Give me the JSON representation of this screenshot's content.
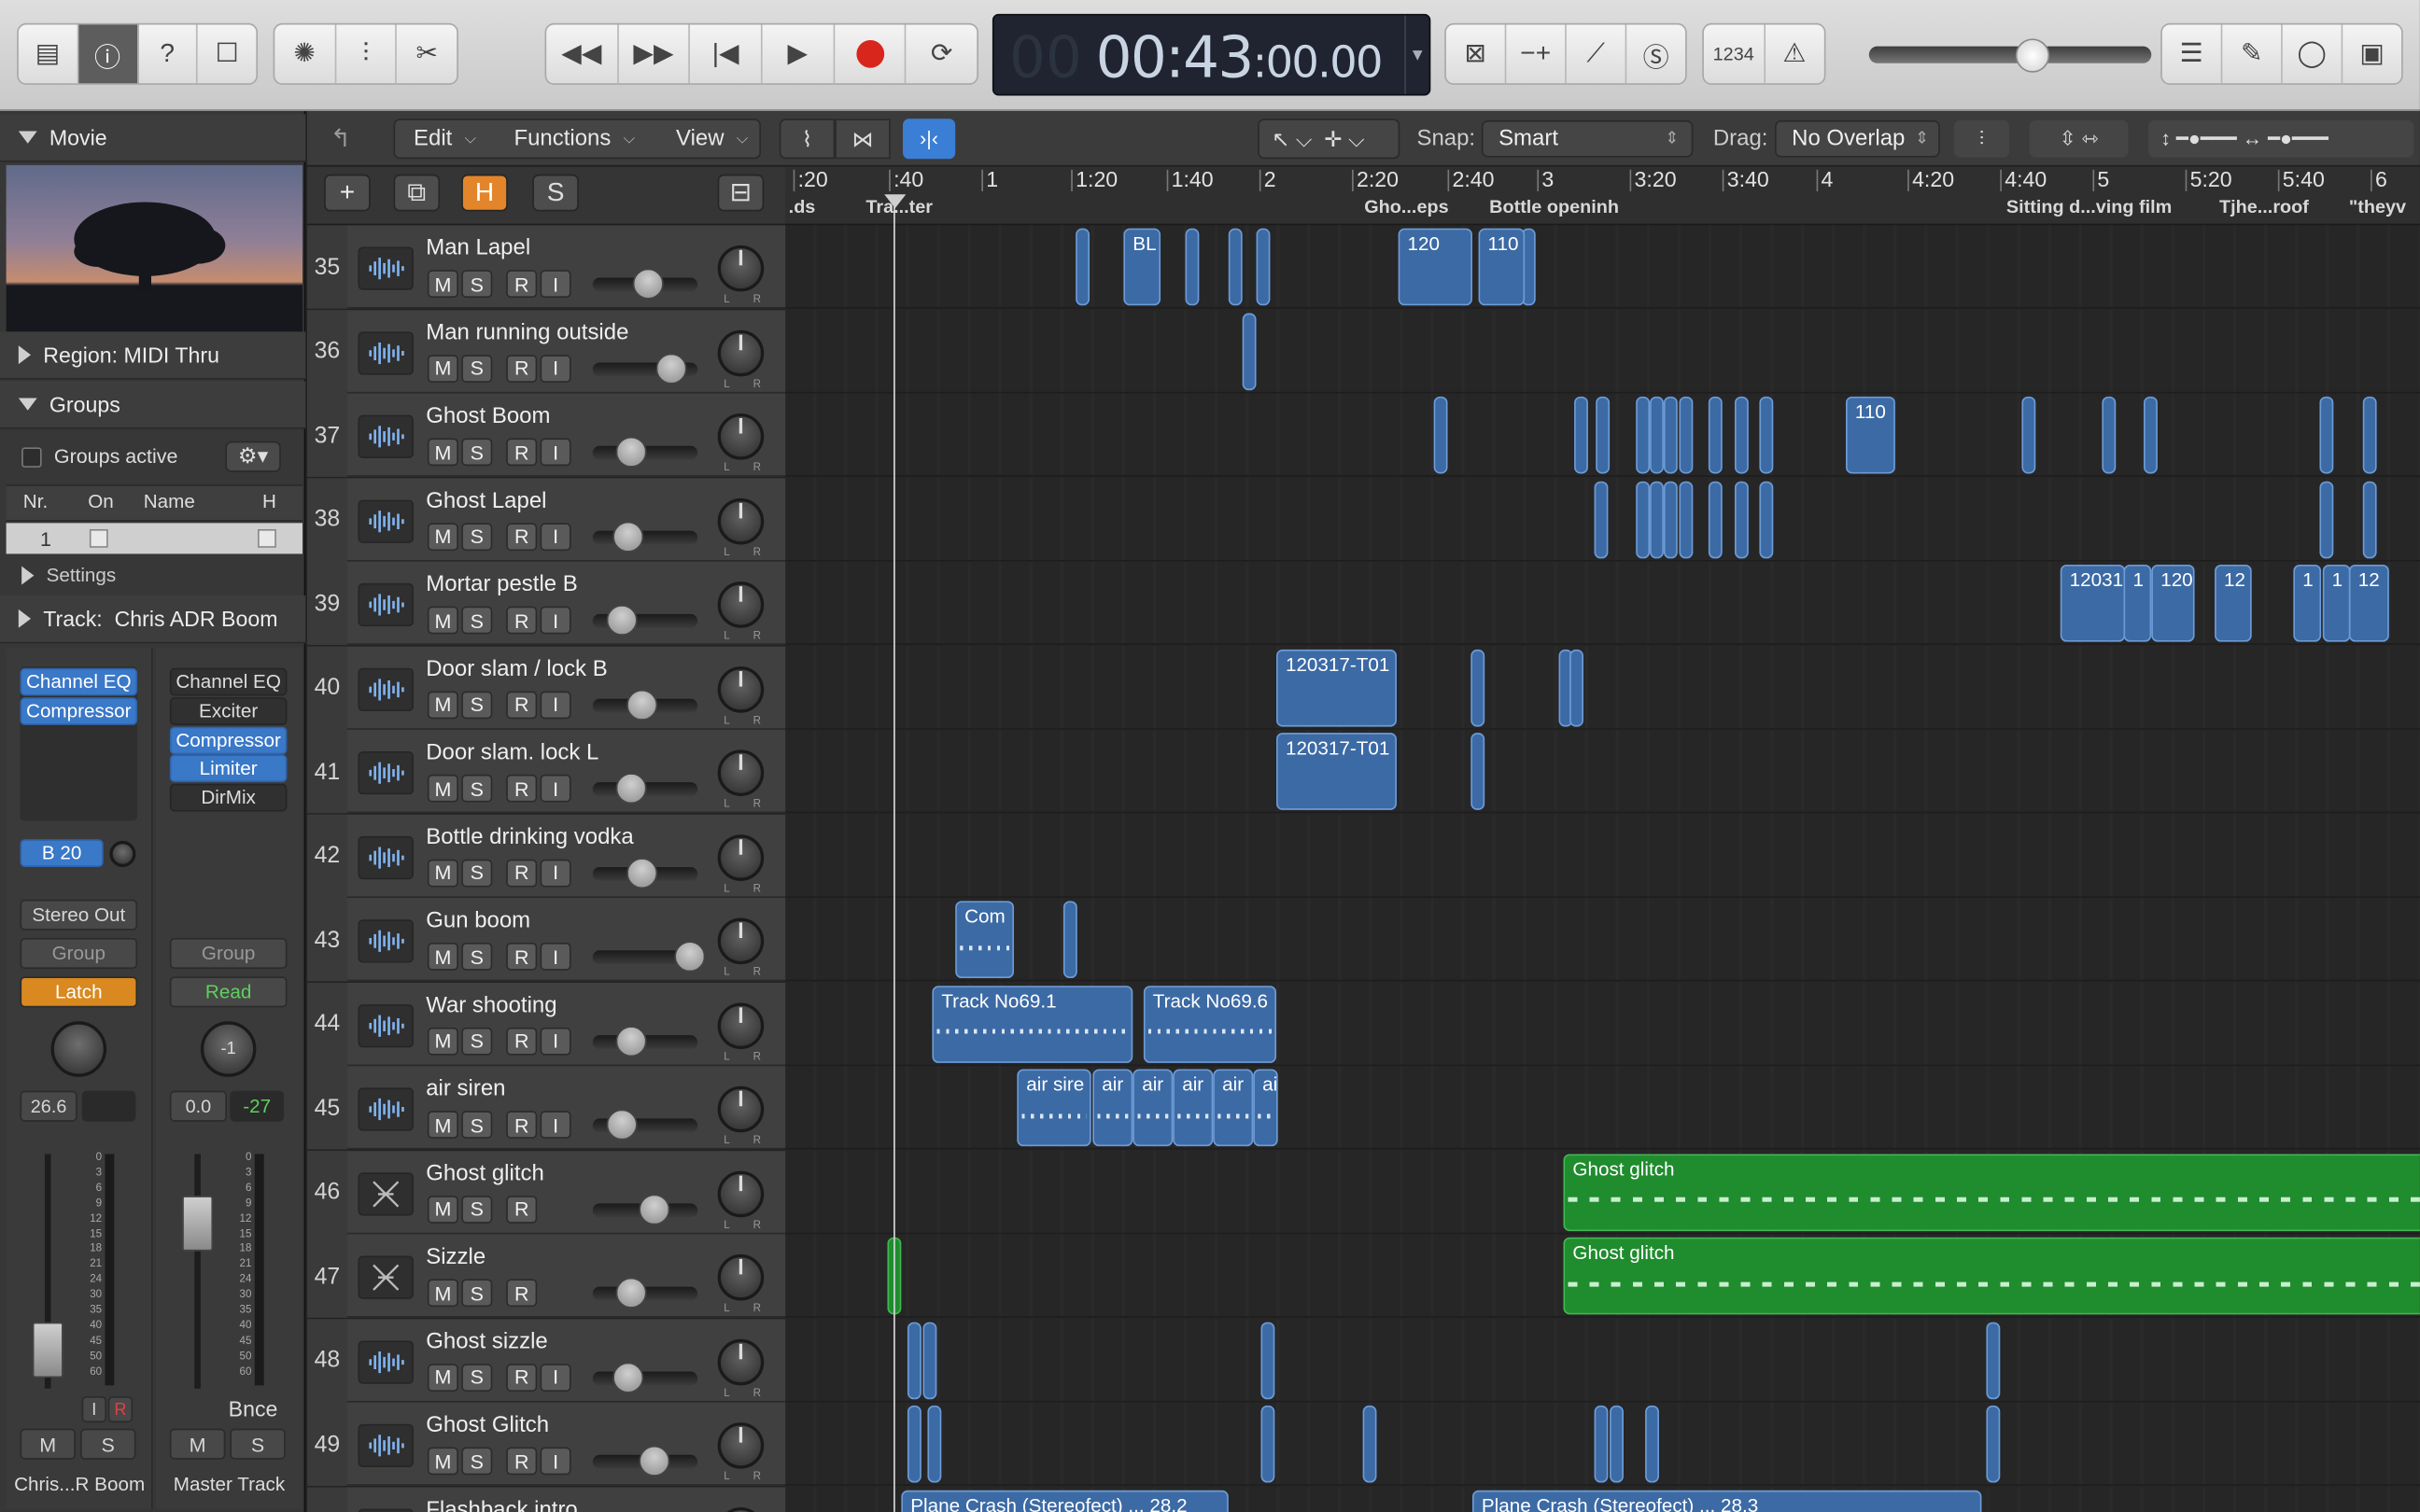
{
  "control_bar": {
    "timecode_ghost": "00",
    "timecode_main": "00:43",
    "timecode_frames": ":00.00",
    "count_in_label": "1234",
    "left_buttons": [
      "library-icon",
      "info-icon",
      "help-icon",
      "toolbar-icon"
    ],
    "mid_buttons": [
      "smart-controls-icon",
      "mixer-icon",
      "scissors-icon"
    ],
    "transport": [
      "rewind-icon",
      "forward-icon",
      "go-to-start-icon",
      "play-icon",
      "record-icon",
      "cycle-icon"
    ],
    "right_buttons": [
      "replace-icon",
      "punch-icon",
      "tuner-icon",
      "solo-icon"
    ],
    "far_right": [
      "list-editors-icon",
      "note-pad-icon",
      "loop-browser-icon",
      "browsers-icon"
    ]
  },
  "arrange_menu": {
    "edit": "Edit",
    "functions": "Functions",
    "view": "View",
    "snap_label": "Snap:",
    "snap_value": "Smart",
    "drag_label": "Drag:",
    "drag_value": "No Overlap"
  },
  "track_header_buttons": {
    "add": "+",
    "h": "H",
    "s": "S"
  },
  "inspector": {
    "movie_label": "Movie",
    "region_label": "Region:",
    "region_value": "MIDI Thru",
    "groups_label": "Groups",
    "groups_active": "Groups active",
    "group_cols": [
      "Nr.",
      "On",
      "Name",
      "H"
    ],
    "group_row_nr": "1",
    "settings_label": "Settings",
    "track_label": "Track:",
    "track_value": "Chris ADR Boom",
    "left_strip": {
      "plugins": [
        "Channel EQ",
        "Compressor"
      ],
      "send": "B 20",
      "output": "Stereo Out",
      "group": "Group",
      "automation": "Latch",
      "volume": "26.6",
      "input_btn": "I",
      "rec_btn": "R",
      "mute": "M",
      "solo": "S",
      "name": "Chris...R Boom"
    },
    "right_strip": {
      "plugins": [
        "Channel EQ",
        "Exciter",
        "Compressor",
        "Limiter",
        "DirMix"
      ],
      "group": "Group",
      "automation": "Read",
      "pan_value": "-1",
      "volume": "0.0",
      "peak": "-27",
      "bounce": "Bnce",
      "mute": "M",
      "solo": "S",
      "name": "Master Track"
    },
    "meter_scale": [
      "0",
      "3",
      "6",
      "9",
      "12",
      "15",
      "18",
      "21",
      "24",
      "30",
      "35",
      "40",
      "45",
      "50",
      "60"
    ]
  },
  "ruler": {
    "ticks": [
      ":20",
      ":40",
      "1",
      "1:20",
      "1:40",
      "2",
      "2:20",
      "2:40",
      "3",
      "3:20",
      "3:40",
      "4",
      "4:20",
      "4:40",
      "5",
      "5:20",
      "5:40",
      "6"
    ],
    "markers": [
      ".ds",
      "Tra...ter",
      "Gho...eps",
      "Bottle openinh",
      "Sitting d...ving film",
      "Tjhe...roof",
      "\"theyv"
    ]
  },
  "tracks": [
    {
      "num": "35",
      "name": "Man Lapel",
      "type": "audio",
      "fader": 0.45,
      "rec": true
    },
    {
      "num": "36",
      "name": "Man running outside",
      "type": "audio",
      "fader": 0.7,
      "rec": true
    },
    {
      "num": "37",
      "name": "Ghost Boom",
      "type": "audio",
      "fader": 0.25,
      "rec": true
    },
    {
      "num": "38",
      "name": "Ghost Lapel",
      "type": "audio",
      "fader": 0.22,
      "rec": true
    },
    {
      "num": "39",
      "name": "Mortar pestle B",
      "type": "audio",
      "fader": 0.15,
      "rec": true
    },
    {
      "num": "40",
      "name": "Door slam / lock B",
      "type": "audio",
      "fader": 0.38,
      "rec": true
    },
    {
      "num": "41",
      "name": "Door slam. lock L",
      "type": "audio",
      "fader": 0.25,
      "rec": true
    },
    {
      "num": "42",
      "name": "Bottle drinking vodka",
      "type": "audio",
      "fader": 0.38,
      "rec": true
    },
    {
      "num": "43",
      "name": "Gun boom",
      "type": "audio",
      "fader": 0.92,
      "rec": true
    },
    {
      "num": "44",
      "name": "War shooting",
      "type": "audio",
      "fader": 0.25,
      "rec": true
    },
    {
      "num": "45",
      "name": "air siren",
      "type": "audio",
      "fader": 0.15,
      "rec": true
    },
    {
      "num": "46",
      "name": "Ghost glitch",
      "type": "instrument",
      "fader": 0.52,
      "rec": false
    },
    {
      "num": "47",
      "name": "Sizzle",
      "type": "instrument",
      "fader": 0.25,
      "rec": false
    },
    {
      "num": "48",
      "name": "Ghost sizzle",
      "type": "audio",
      "fader": 0.22,
      "rec": true
    },
    {
      "num": "49",
      "name": "Ghost Glitch",
      "type": "audio",
      "fader": 0.52,
      "rec": true
    },
    {
      "num": "",
      "name": "Flashback intro",
      "type": "audio",
      "fader": 0.5,
      "rec": true
    }
  ],
  "track_buttons": {
    "m": "M",
    "s": "S",
    "r": "R",
    "i": "I"
  },
  "regions": [
    {
      "row": 0,
      "label": "BL"
    },
    {
      "row": 0,
      "label": "120"
    },
    {
      "row": 0,
      "label": "110"
    },
    {
      "row": 2,
      "label": "110"
    },
    {
      "row": 4,
      "label": "12031"
    },
    {
      "row": 4,
      "label": "1"
    },
    {
      "row": 4,
      "label": "120"
    },
    {
      "row": 4,
      "label": "12"
    },
    {
      "row": 4,
      "label": "1"
    },
    {
      "row": 4,
      "label": "1"
    },
    {
      "row": 4,
      "label": "12"
    },
    {
      "row": 5,
      "label": "120317-T01"
    },
    {
      "row": 6,
      "label": "120317-T01"
    },
    {
      "row": 8,
      "label": "Com"
    },
    {
      "row": 9,
      "label": "Track No69.1"
    },
    {
      "row": 9,
      "label": "Track No69.6"
    },
    {
      "row": 10,
      "label": "air sire"
    },
    {
      "row": 10,
      "label": "air"
    },
    {
      "row": 10,
      "label": "air"
    },
    {
      "row": 10,
      "label": "air"
    },
    {
      "row": 10,
      "label": "air"
    },
    {
      "row": 10,
      "label": "ai"
    },
    {
      "row": 11,
      "label": "Ghost glitch"
    },
    {
      "row": 12,
      "label": "Ghost glitch"
    },
    {
      "row": 15,
      "label": "Plane Crash (Stereofect) ... 28.2"
    },
    {
      "row": 15,
      "label": "Plane Crash (Stereofect) ... 28.3"
    }
  ]
}
